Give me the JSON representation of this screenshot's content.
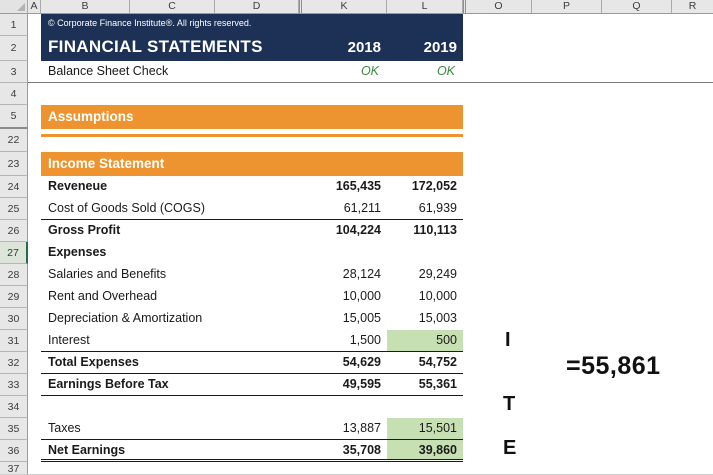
{
  "colors": {
    "navy": "#1d3055",
    "orange": "#ed9430",
    "green_fill": "#c6e0b4",
    "ok_green": "#3a8a3d"
  },
  "sheet": {
    "columns": [
      "A",
      "B",
      "C",
      "D",
      "K",
      "L",
      "O",
      "P",
      "Q",
      "R"
    ],
    "rows": [
      "1",
      "2",
      "3",
      "4",
      "5",
      "22",
      "23",
      "24",
      "25",
      "26",
      "27",
      "28",
      "29",
      "30",
      "31",
      "32",
      "33",
      "34",
      "35",
      "36",
      "37"
    ]
  },
  "header": {
    "copyright": "© Corporate Finance Institute®. All rights reserved.",
    "title": "FINANCIAL STATEMENTS",
    "year1": "2018",
    "year2": "2019"
  },
  "balance_check": {
    "label": "Balance Sheet Check",
    "y2018": "OK",
    "y2019": "OK"
  },
  "sections": {
    "assumptions": "Assumptions",
    "income_statement": "Income Statement"
  },
  "income": {
    "rows": [
      {
        "label": "Reveneue",
        "y2018": "165,435",
        "y2019": "172,052"
      },
      {
        "label": "Cost of Goods Sold (COGS)",
        "y2018": "61,211",
        "y2019": "61,939"
      },
      {
        "label": "Gross Profit",
        "y2018": "104,224",
        "y2019": "110,113"
      },
      {
        "label": "Expenses",
        "y2018": "",
        "y2019": ""
      },
      {
        "label": "Salaries and Benefits",
        "y2018": "28,124",
        "y2019": "29,249"
      },
      {
        "label": "Rent and Overhead",
        "y2018": "10,000",
        "y2019": "10,000"
      },
      {
        "label": "Depreciation & Amortization",
        "y2018": "15,005",
        "y2019": "15,003"
      },
      {
        "label": "Interest",
        "y2018": "1,500",
        "y2019": "500"
      },
      {
        "label": "Total Expenses",
        "y2018": "54,629",
        "y2019": "54,752"
      },
      {
        "label": "Earnings Before Tax",
        "y2018": "49,595",
        "y2019": "55,361"
      },
      {
        "label": "",
        "y2018": "",
        "y2019": ""
      },
      {
        "label": "Taxes",
        "y2018": "13,887",
        "y2019": "15,501"
      },
      {
        "label": "Net Earnings",
        "y2018": "35,708",
        "y2019": "39,860"
      }
    ]
  },
  "annotations": {
    "letter_i": "I",
    "letter_t": "T",
    "letter_e": "E",
    "formula": "=55,861"
  }
}
